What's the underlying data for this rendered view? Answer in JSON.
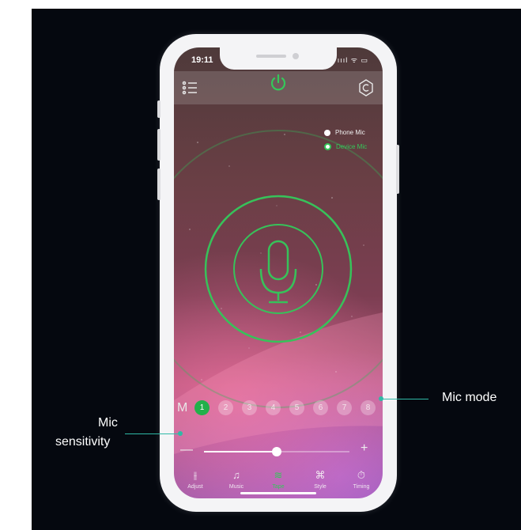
{
  "status": {
    "time": "19:11",
    "signal": "ıııl ᯤ ▭"
  },
  "mic_source": {
    "options": [
      {
        "label": "Phone Mic",
        "selected": false
      },
      {
        "label": "Device Mic",
        "selected": true
      }
    ]
  },
  "modes": {
    "prefix": "M",
    "items": [
      "1",
      "2",
      "3",
      "4",
      "5",
      "6",
      "7",
      "8"
    ],
    "active_index": 0
  },
  "sensitivity": {
    "value_fraction": 0.5,
    "minus": "—",
    "plus": "+"
  },
  "tabs": [
    {
      "label": "Adjust",
      "icon": "sliders-icon",
      "glyph": "⫲"
    },
    {
      "label": "Music",
      "icon": "music-note-icon",
      "glyph": "♫"
    },
    {
      "label": "Tape",
      "icon": "tape-icon",
      "glyph": "≋"
    },
    {
      "label": "Style",
      "icon": "command-icon",
      "glyph": "⌘"
    },
    {
      "label": "Timing",
      "icon": "timer-icon",
      "glyph": "⏱"
    }
  ],
  "active_tab": 2,
  "annotations": {
    "mic_mode": "Mic mode",
    "mic_sensitivity_1": "Mic",
    "mic_sensitivity_2": "sensitivity"
  },
  "colors": {
    "accent": "#34c85a",
    "annotation": "#2fb9a6",
    "background": "#05080f"
  }
}
